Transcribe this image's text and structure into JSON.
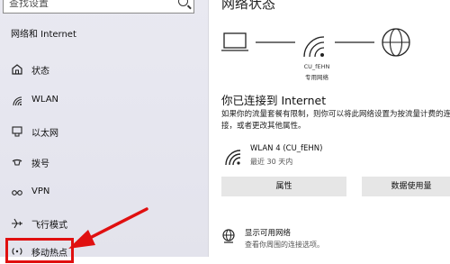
{
  "sidebar": {
    "search_placeholder": "查找设置",
    "section_title": "网络和 Internet",
    "items": [
      {
        "label": "状态",
        "icon": "home-status-icon"
      },
      {
        "label": "WLAN",
        "icon": "wifi-icon"
      },
      {
        "label": "以太网",
        "icon": "ethernet-icon"
      },
      {
        "label": "拨号",
        "icon": "dialup-icon"
      },
      {
        "label": "VPN",
        "icon": "vpn-icon"
      },
      {
        "label": "飞行模式",
        "icon": "airplane-icon"
      },
      {
        "label": "移动热点",
        "icon": "hotspot-icon"
      }
    ]
  },
  "main": {
    "heading": "网络状态",
    "diagram": {
      "ssid": "CU_fEHN",
      "network_type": "专用网络"
    },
    "status_title": "你已连接到 Internet",
    "status_desc": "如果你的流量套餐有限制，则你可以将此网络设置为按流量计费的连接，或者更改其他属性。",
    "connection": {
      "name": "WLAN 4 (CU_fEHN)",
      "usage": "最近 30 天内"
    },
    "buttons": {
      "properties": "属性",
      "data_usage": "数据使用量"
    },
    "available": {
      "title": "显示可用网络",
      "desc": "查看你周围的连接选项。"
    }
  },
  "colors": {
    "annotation": "#e01010",
    "button_bg": "#e6e6e6",
    "sidebar_bg": "#e6e6ef"
  }
}
